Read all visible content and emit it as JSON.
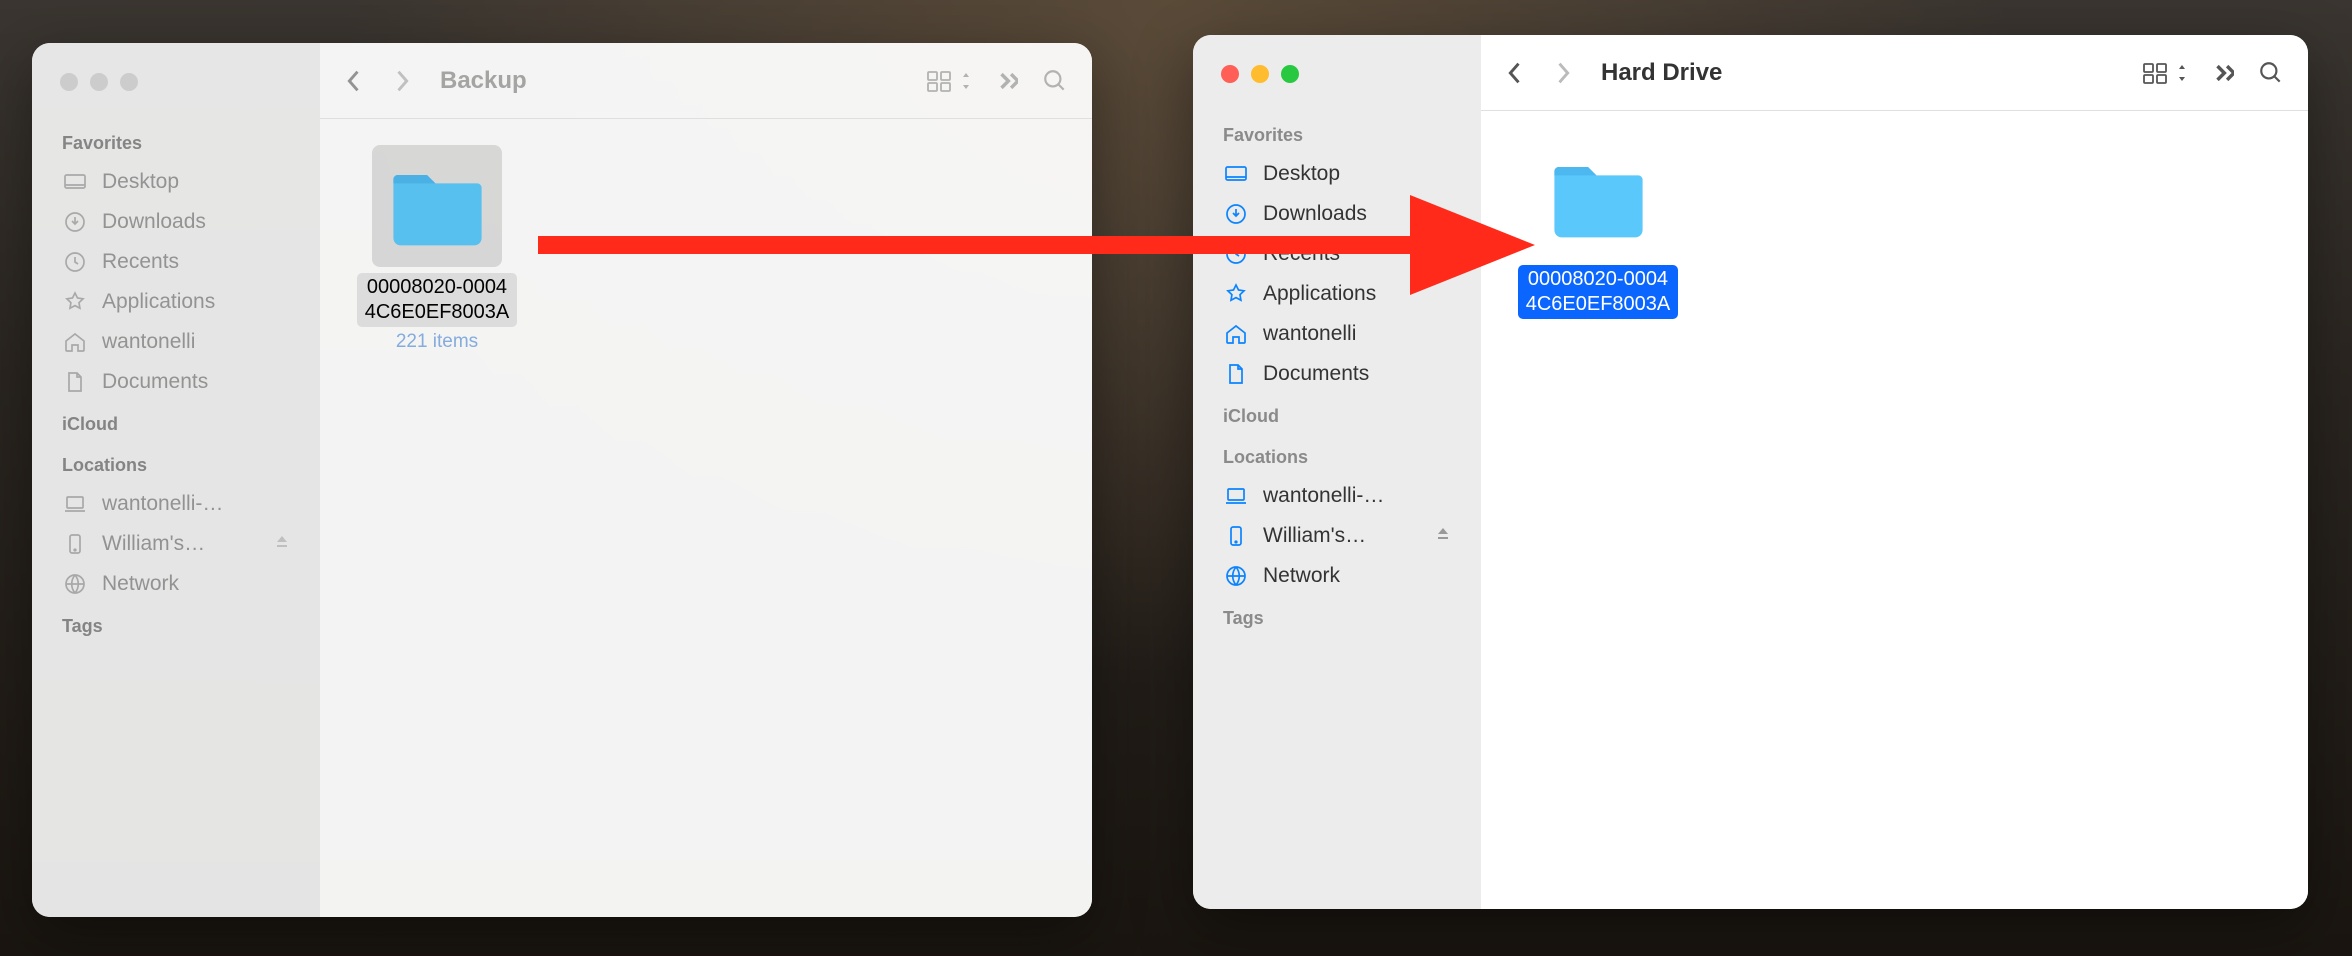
{
  "windows": [
    {
      "id": "left",
      "title": "Backup",
      "active": false,
      "sidebar": {
        "favorites_header": "Favorites",
        "favorites": [
          {
            "icon": "desktop",
            "label": "Desktop"
          },
          {
            "icon": "download",
            "label": "Downloads"
          },
          {
            "icon": "recents",
            "label": "Recents"
          },
          {
            "icon": "apps",
            "label": "Applications"
          },
          {
            "icon": "home",
            "label": "wantonelli"
          },
          {
            "icon": "document",
            "label": "Documents"
          }
        ],
        "icloud_header": "iCloud",
        "locations_header": "Locations",
        "locations": [
          {
            "icon": "laptop",
            "label": "wantonelli-…",
            "eject": false
          },
          {
            "icon": "phone",
            "label": "William's…",
            "eject": true
          },
          {
            "icon": "network",
            "label": "Network",
            "eject": false
          }
        ],
        "tags_header": "Tags"
      },
      "content": {
        "items": [
          {
            "name_line1": "00008020-0004",
            "name_line2": "4C6E0EF8003A",
            "count": "221 items",
            "selected": true
          }
        ]
      }
    },
    {
      "id": "right",
      "title": "Hard Drive",
      "active": true,
      "sidebar": {
        "favorites_header": "Favorites",
        "favorites": [
          {
            "icon": "desktop",
            "label": "Desktop"
          },
          {
            "icon": "download",
            "label": "Downloads"
          },
          {
            "icon": "recents",
            "label": "Recents"
          },
          {
            "icon": "apps",
            "label": "Applications"
          },
          {
            "icon": "home",
            "label": "wantonelli"
          },
          {
            "icon": "document",
            "label": "Documents"
          }
        ],
        "icloud_header": "iCloud",
        "locations_header": "Locations",
        "locations": [
          {
            "icon": "laptop",
            "label": "wantonelli-…",
            "eject": false
          },
          {
            "icon": "phone",
            "label": "William's…",
            "eject": true
          },
          {
            "icon": "network",
            "label": "Network",
            "eject": false
          }
        ],
        "tags_header": "Tags"
      },
      "content": {
        "items": [
          {
            "name_line1": "00008020-0004",
            "name_line2": "4C6E0EF8003A",
            "selected": true
          }
        ]
      }
    }
  ],
  "icons": {
    "desktop": "desktop-icon",
    "download": "download-icon",
    "recents": "clock-icon",
    "apps": "apps-icon",
    "home": "home-icon",
    "document": "document-icon",
    "laptop": "laptop-icon",
    "phone": "phone-icon",
    "network": "network-icon"
  }
}
